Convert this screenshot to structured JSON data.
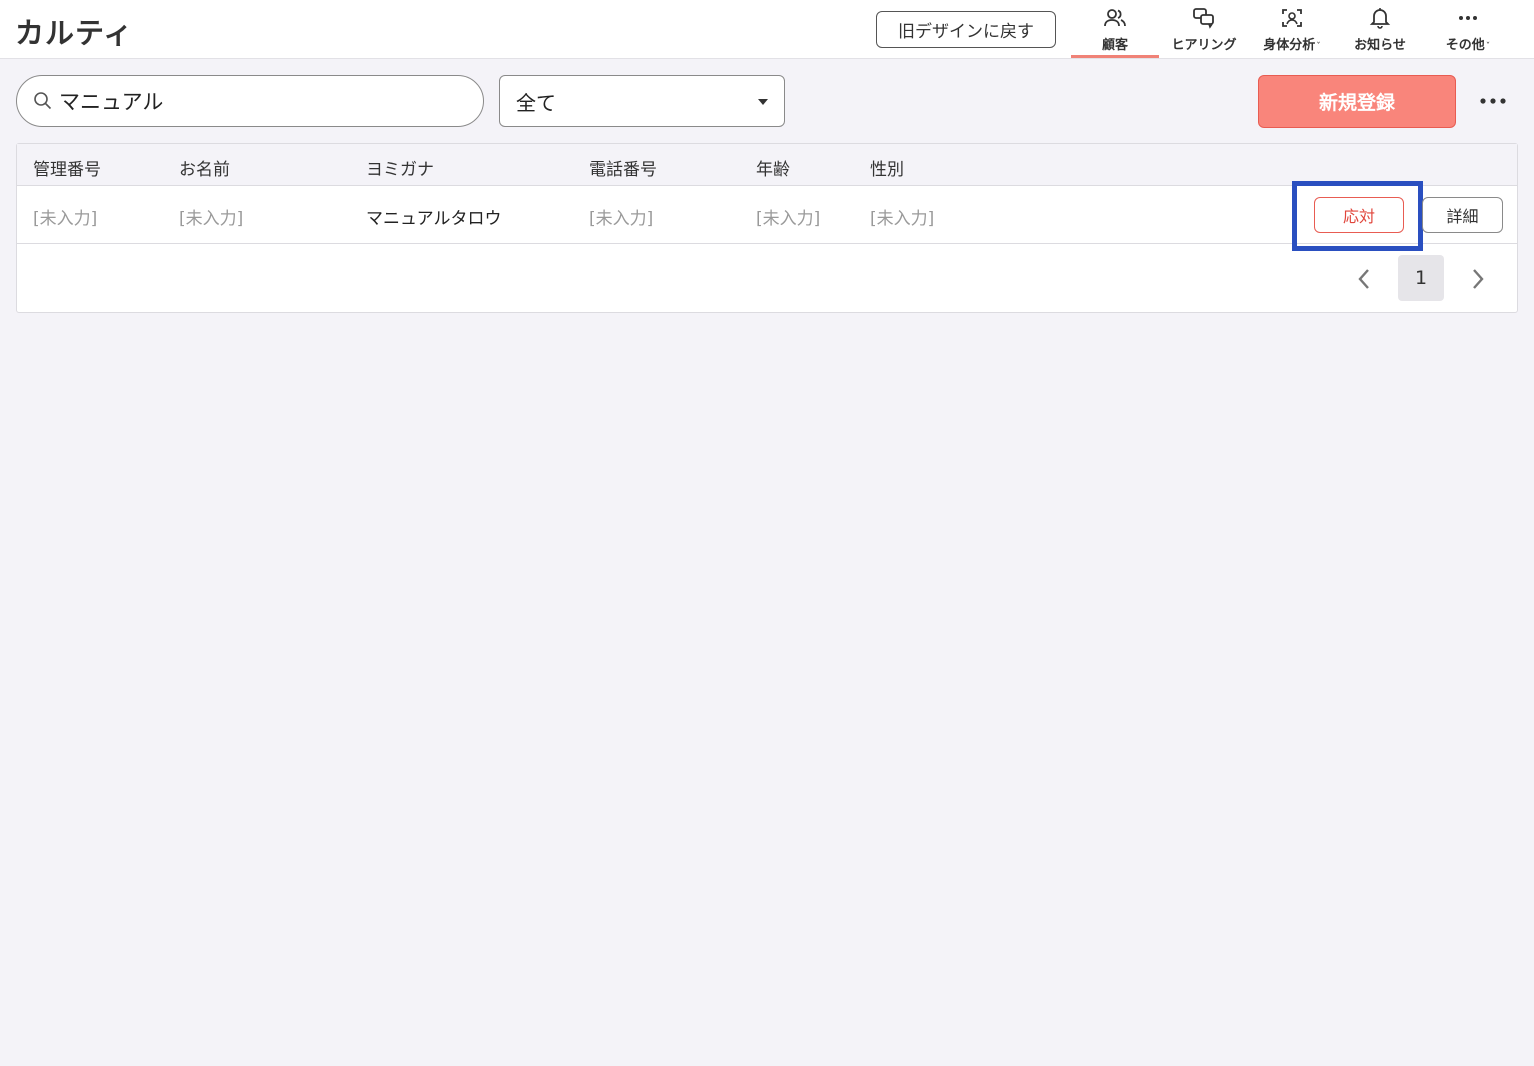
{
  "header": {
    "logo": "カルティ",
    "old_design_label": "旧デザインに戻す",
    "nav": [
      {
        "label": "顧客",
        "icon": "users-icon",
        "active": true,
        "dropdown": false
      },
      {
        "label": "ヒアリング",
        "icon": "chat-bubbles-icon",
        "active": false,
        "dropdown": false
      },
      {
        "label": "身体分析",
        "icon": "face-scan-icon",
        "active": false,
        "dropdown": true
      },
      {
        "label": "お知らせ",
        "icon": "bell-icon",
        "active": false,
        "dropdown": false
      },
      {
        "label": "その他",
        "icon": "ellipsis-icon",
        "active": false,
        "dropdown": true
      }
    ]
  },
  "toolbar": {
    "search_value": "マニュアル",
    "filter_value": "全て",
    "new_label": "新規登録",
    "more_label": "•••"
  },
  "table": {
    "columns": [
      "管理番号",
      "お名前",
      "ヨミガナ",
      "電話番号",
      "年齢",
      "性別"
    ],
    "rows": [
      {
        "cells": [
          "[未入力]",
          "[未入力]",
          "マニュアルタロウ",
          "[未入力]",
          "[未入力]",
          "[未入力]"
        ],
        "respond_label": "応対",
        "detail_label": "詳細"
      }
    ]
  },
  "pagination": {
    "current_page": "1"
  },
  "colors": {
    "accent": "#f9857b",
    "accent_border": "#e85c52",
    "highlight": "#2a4fc0"
  }
}
